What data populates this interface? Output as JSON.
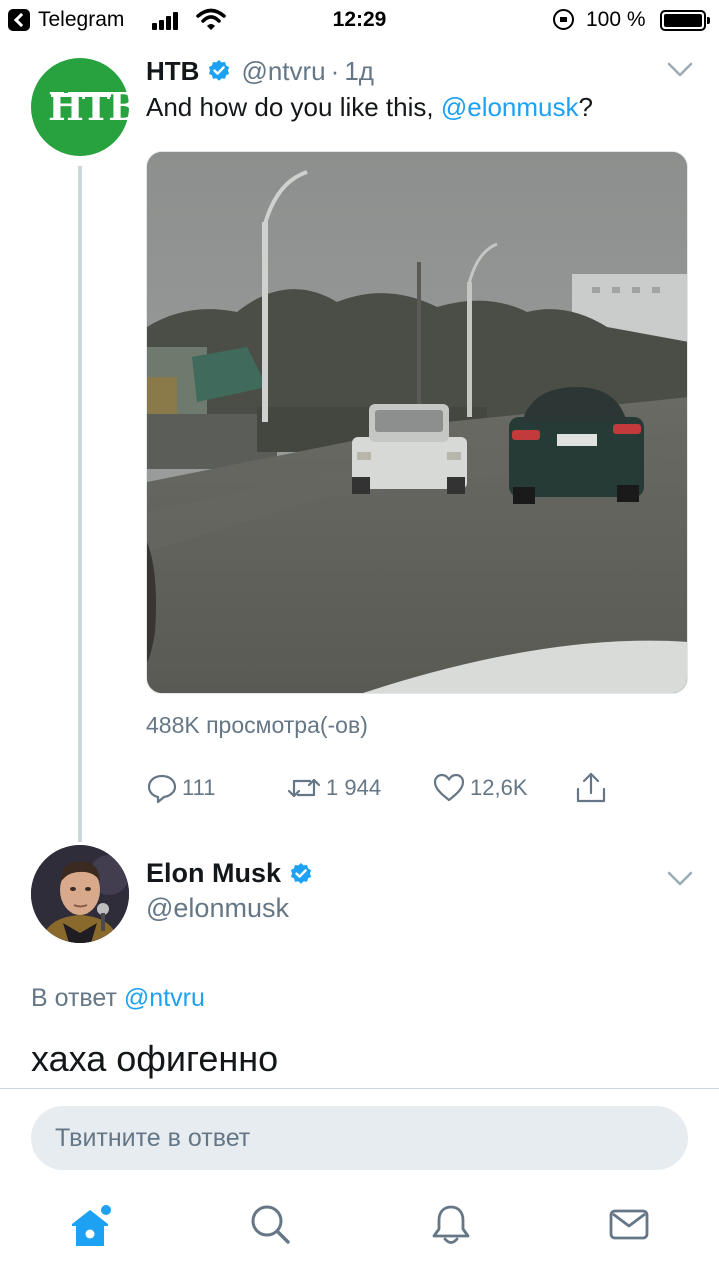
{
  "status_bar": {
    "back_app": "Telegram",
    "time": "12:29",
    "battery": "100 %"
  },
  "tweet_original": {
    "author_name": "НТВ",
    "author_handle": "@ntvru",
    "separator": "·",
    "time_ago": "1д",
    "text_prefix": "And how do you like this, ",
    "text_mention": "@elonmusk",
    "text_suffix": "?",
    "avatar_logo": "НТВ",
    "views": "488K просмотра(-ов)",
    "actions": {
      "replies": "111",
      "retweets": "1 944",
      "likes": "12,6K"
    }
  },
  "tweet_reply": {
    "author_name": "Elon Musk",
    "author_handle": "@elonmusk",
    "reply_label": "В ответ ",
    "reply_mention": "@ntvru",
    "text": "хаха офигенно"
  },
  "composer": {
    "placeholder": "Твитните в ответ"
  },
  "colors": {
    "accent": "#1da1f2",
    "secondary_text": "#657786",
    "ntv_green": "#27a23f"
  },
  "tabbar": {
    "icons": [
      "home-icon",
      "search-icon",
      "notifications-icon",
      "messages-icon"
    ]
  }
}
